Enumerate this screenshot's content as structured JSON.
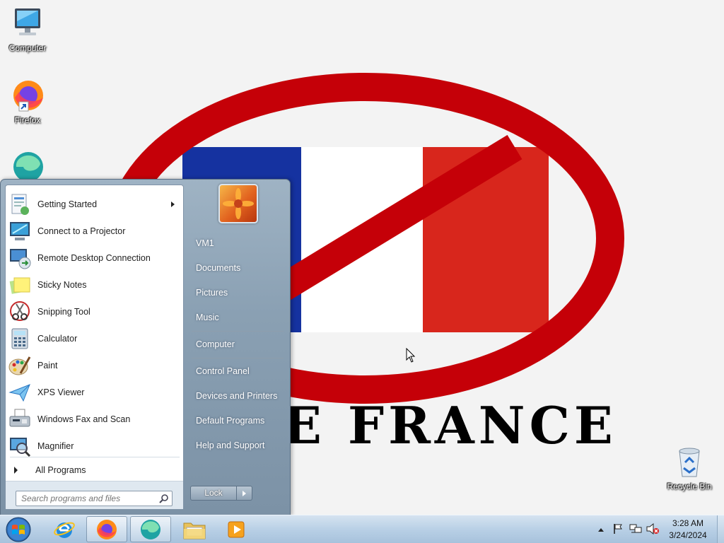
{
  "desktop": {
    "wallpaper_text": "E FRANCE",
    "icons": [
      {
        "label": "Computer",
        "icon": "computer-icon"
      },
      {
        "label": "Firefox",
        "icon": "firefox-icon"
      },
      {
        "label": "",
        "icon": "edge-icon"
      },
      {
        "label": "Recycle Bin",
        "icon": "recycle-bin-icon"
      }
    ]
  },
  "start_menu": {
    "programs": [
      {
        "label": "Getting Started",
        "icon": "getting-started-icon",
        "has_submenu": true
      },
      {
        "label": "Connect to a Projector",
        "icon": "projector-icon"
      },
      {
        "label": "Remote Desktop Connection",
        "icon": "remote-desktop-icon"
      },
      {
        "label": "Sticky Notes",
        "icon": "sticky-notes-icon"
      },
      {
        "label": "Snipping Tool",
        "icon": "snipping-tool-icon"
      },
      {
        "label": "Calculator",
        "icon": "calculator-icon"
      },
      {
        "label": "Paint",
        "icon": "paint-icon"
      },
      {
        "label": "XPS Viewer",
        "icon": "xps-viewer-icon"
      },
      {
        "label": "Windows Fax and Scan",
        "icon": "fax-scan-icon"
      },
      {
        "label": "Magnifier",
        "icon": "magnifier-icon"
      }
    ],
    "all_programs": "All Programs",
    "search_placeholder": "Search programs and files",
    "right_links": [
      "VM1",
      "Documents",
      "Pictures",
      "Music",
      "Computer",
      "Control Panel",
      "Devices and Printers",
      "Default Programs",
      "Help and Support"
    ],
    "lock_label": "Lock"
  },
  "taskbar": {
    "pinned": [
      "start-orb",
      "internet-explorer-icon",
      "firefox-icon",
      "edge-icon",
      "file-explorer-icon",
      "media-player-icon"
    ],
    "active": [
      "firefox-icon",
      "edge-icon"
    ],
    "tray_icons": [
      "show-hidden-icons-icon",
      "action-center-flag-icon",
      "network-icon",
      "volume-muted-icon"
    ],
    "clock": {
      "time": "3:28 AM",
      "date": "3/24/2024"
    }
  },
  "colors": {
    "wallpaper_red": "#c50008",
    "wallpaper_blue": "#1532a0",
    "start_menu": "#8ea3b7",
    "taskbar": "#b9d0e6"
  }
}
